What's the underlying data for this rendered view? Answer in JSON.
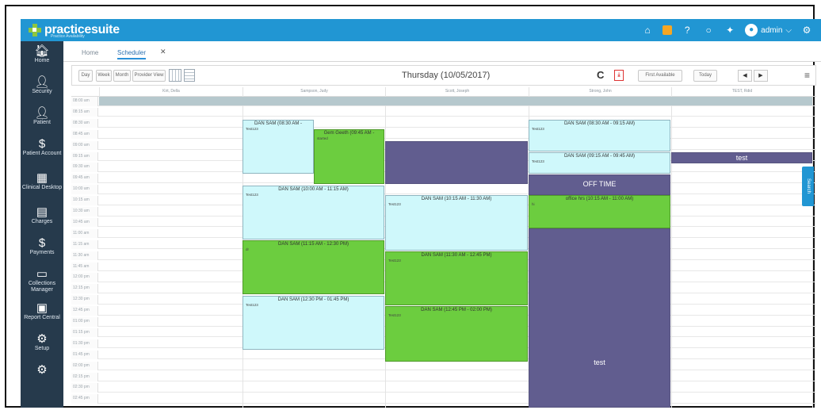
{
  "brand": {
    "name": "practicesuite",
    "tagline": "Practice Availability",
    "colors": {
      "topbar": "#2196d3",
      "sidebar": "#263a4c",
      "appt_cyan": "#cff8fb",
      "appt_green": "#6ccd3f",
      "appt_purple": "#615d8f"
    }
  },
  "topbar": {
    "user": "admin"
  },
  "sidebar": {
    "items": [
      {
        "label": "Home",
        "icon": "home-icon"
      },
      {
        "label": "Security",
        "icon": "user-icon"
      },
      {
        "label": "Patient",
        "icon": "patient-icon"
      },
      {
        "label": "Patient Account",
        "icon": "dollar-icon"
      },
      {
        "label": "Clinical Desktop",
        "icon": "desktop-icon"
      },
      {
        "label": "Charges",
        "icon": "charges-icon"
      },
      {
        "label": "Payments",
        "icon": "dollar-icon"
      },
      {
        "label": "Collections Manager",
        "icon": "folder-icon"
      },
      {
        "label": "Report Central",
        "icon": "report-icon"
      },
      {
        "label": "Setup",
        "icon": "gear-icon"
      }
    ]
  },
  "tabs": [
    {
      "label": "Home"
    },
    {
      "label": "Scheduler",
      "active": true
    }
  ],
  "toolbar": {
    "views": [
      "Day",
      "Week",
      "Month",
      "Provider View"
    ],
    "date_title": "Thursday (10/05/2017)",
    "first_available": "First Available",
    "today": "Today",
    "prev": "◀",
    "next": "▶"
  },
  "providers": [
    "Kirt, Della",
    "Sampson, Judy",
    "Scott, Joseph",
    "Strong, John",
    "TEST, Rdid"
  ],
  "times": [
    "08:00 am",
    "08:15 am",
    "08:30 am",
    "08:45 am",
    "09:00 am",
    "09:15 am",
    "09:30 am",
    "09:45 am",
    "10:00 am",
    "10:15 am",
    "10:30 am",
    "10:45 am",
    "11:00 am",
    "11:15 am",
    "11:30 am",
    "11:45 am",
    "12:00 pm",
    "12:15 pm",
    "12:30 pm",
    "12:45 pm",
    "01:00 pm",
    "01:15 pm",
    "01:30 pm",
    "01:45 pm",
    "02:00 pm",
    "02:15 pm",
    "02:30 pm",
    "02:45 pm"
  ],
  "appointments": {
    "a1": {
      "title": "DAN SAM (08:30 AM -",
      "note": "Test123"
    },
    "a2": {
      "title": "Gem Geeth (09:45 AM -",
      "note": "started"
    },
    "a3": {
      "title": "DAN SAM (10:00 AM - 11:15 AM)",
      "note": "Test123"
    },
    "a4": {
      "title": "DAN SAM (11:15 AM - 12:30 PM)",
      "note": "dr"
    },
    "a5": {
      "title": "DAN SAM (12:30 PM - 01:45 PM)",
      "note": "Test123"
    },
    "b2": {
      "title": "DAN SAM (10:15 AM - 11:30 AM)",
      "note": "Test123"
    },
    "b3": {
      "title": "DAN SAM (11:30 AM - 12:45 PM)",
      "note": "Test123"
    },
    "b4": {
      "title": "DAN SAM (12:45 PM - 02:00 PM)",
      "note": "Test123"
    },
    "c1": {
      "title": "DAN SAM (08:30 AM - 09:15 AM)",
      "note": "Test123"
    },
    "c2": {
      "title": "DAN SAM (09:15 AM - 09:45 AM)",
      "note": "Test123"
    },
    "c3": {
      "title": "OFF TIME"
    },
    "c4": {
      "title": "office hrs (10:15 AM - 11:00 AM)",
      "note": "hi"
    },
    "c5": {
      "title": "test"
    },
    "d1": {
      "title": "test"
    }
  },
  "search_tab": "Search"
}
